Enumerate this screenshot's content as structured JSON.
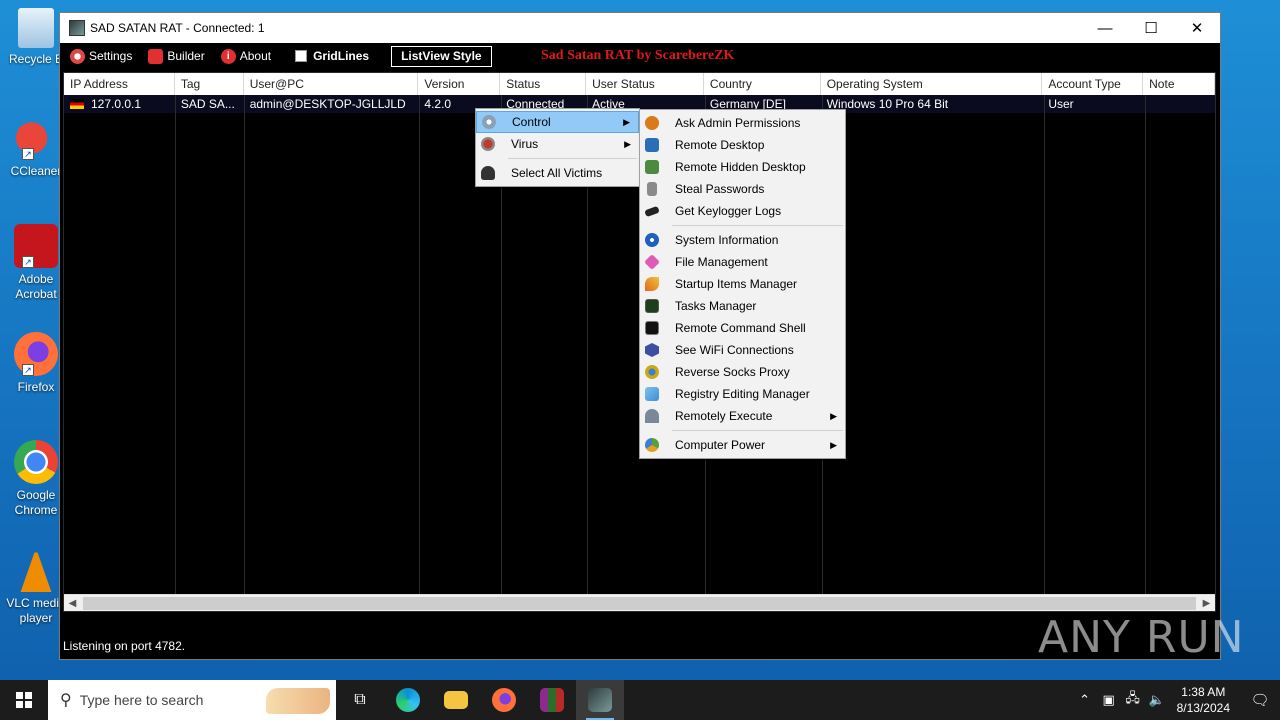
{
  "desktop": {
    "icons": [
      {
        "label": "Recycle B",
        "color": "#cfe3f3"
      },
      {
        "label": "CCleaner",
        "color": "#e9453a"
      },
      {
        "label": "Adobe Acrobat",
        "color": "#c4161c"
      },
      {
        "label": "Firefox",
        "color": "#ff7139"
      },
      {
        "label": "Google Chrome",
        "color": "#34a853"
      },
      {
        "label": "VLC media player",
        "color": "#f08c00"
      }
    ]
  },
  "window": {
    "title": "SAD SATAN RAT - Connected: 1",
    "minimize": "—",
    "maximize": "☐",
    "close": "✕"
  },
  "menubar": {
    "settings": "Settings",
    "builder": "Builder",
    "about": "About",
    "gridlines": "GridLines",
    "listview_style": "ListView Style",
    "brand": "Sad Satan RAT by ScarebereZK"
  },
  "table": {
    "columns": [
      "IP Address",
      "Tag",
      "User@PC",
      "Version",
      "Status",
      "User Status",
      "Country",
      "Operating System",
      "Account Type",
      "Note"
    ],
    "rows": [
      [
        "127.0.0.1",
        "SAD SA...",
        "admin@DESKTOP-JGLLJLD",
        "4.2.0",
        "Connected",
        "Active",
        "Germany [DE]",
        "Windows 10 Pro 64 Bit",
        "User",
        ""
      ]
    ]
  },
  "context_menu": {
    "items": [
      {
        "label": "Control",
        "icon": "gear-icon",
        "color": "#8aa0b6",
        "submenu": true
      },
      {
        "label": "Virus",
        "icon": "virus-icon",
        "color": "#c0392b",
        "submenu": true
      },
      {
        "label": "Select All Victims",
        "icon": "hat-icon",
        "color": "#333333",
        "submenu": false
      }
    ]
  },
  "control_submenu": {
    "group1": [
      {
        "label": "Ask Admin Permissions",
        "icon": "admin-shield-icon",
        "color": "#d97b1a"
      },
      {
        "label": "Remote Desktop",
        "icon": "monitor-icon",
        "color": "#2a6fb5"
      },
      {
        "label": "Remote Hidden Desktop",
        "icon": "hidden-monitor-icon",
        "color": "#4c8a3f"
      },
      {
        "label": "Steal Passwords",
        "icon": "key-icon",
        "color": "#8a8a8a"
      },
      {
        "label": "Get Keylogger Logs",
        "icon": "keyboard-icon",
        "color": "#222222"
      }
    ],
    "group2": [
      {
        "label": "System Information",
        "icon": "info-icon",
        "color": "#1f5fbf"
      },
      {
        "label": "File Management",
        "icon": "folder-icon",
        "color": "#e05bb5"
      },
      {
        "label": "Startup Items Manager",
        "icon": "rocket-icon",
        "color": "#e06a1a"
      },
      {
        "label": "Tasks Manager",
        "icon": "tasks-icon",
        "color": "#1d3d1d"
      },
      {
        "label": "Remote Command Shell",
        "icon": "terminal-icon",
        "color": "#111111"
      },
      {
        "label": "See WiFi Connections",
        "icon": "wifi-icon",
        "color": "#3d4fa0"
      },
      {
        "label": "Reverse Socks Proxy",
        "icon": "proxy-icon",
        "color": "#c9a81a"
      },
      {
        "label": "Registry Editing Manager",
        "icon": "registry-icon",
        "color": "#3a8fd0"
      },
      {
        "label": "Remotely Execute",
        "icon": "execute-icon",
        "color": "#7a8899",
        "submenu": true
      }
    ],
    "group3": [
      {
        "label": "Computer Power",
        "icon": "power-icon",
        "color": "#5aa03a",
        "submenu": true
      }
    ]
  },
  "statusbar": {
    "text": "Listening on port 4782."
  },
  "taskbar": {
    "search_placeholder": "Type here to search",
    "time": "1:38 AM",
    "date": "8/13/2024"
  },
  "watermark": "ANY RUN"
}
